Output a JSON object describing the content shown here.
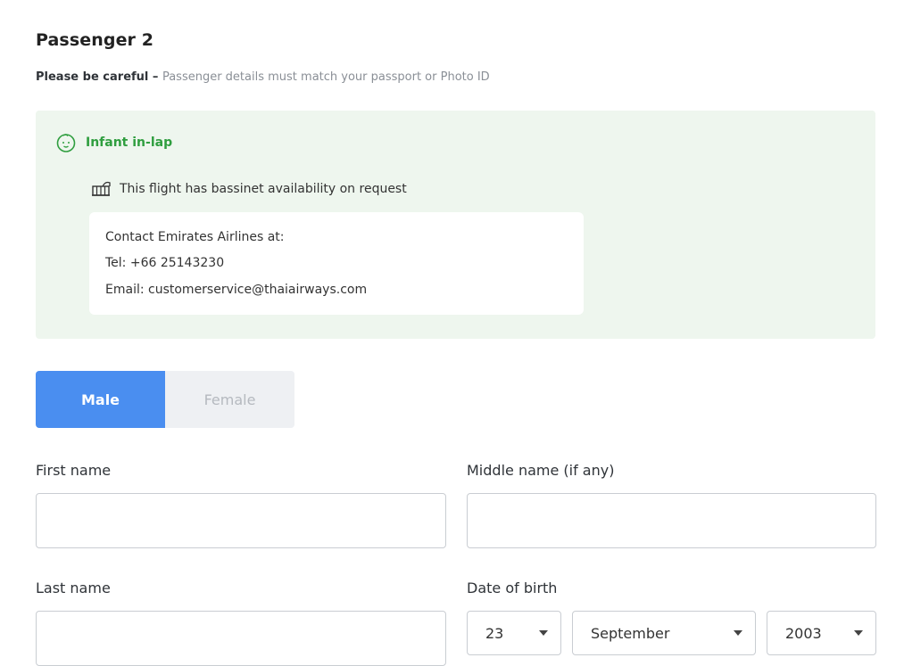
{
  "header": {
    "title": "Passenger 2",
    "warning_strong": "Please be careful",
    "warning_sep": " – ",
    "warning_text": "Passenger details must match your passport or Photo ID"
  },
  "infant": {
    "icon": "baby-face-icon",
    "label": "Infant in-lap",
    "bassinet_icon": "bassinet-icon",
    "bassinet_text": "This flight has bassinet availability on request",
    "contact": {
      "heading": "Contact Emirates Airlines at:",
      "tel": "Tel: +66 25143230",
      "email": "Email: customerservice@thaiairways.com"
    }
  },
  "gender": {
    "male": "Male",
    "female": "Female",
    "selected": "Male"
  },
  "form": {
    "first_name_label": "First name",
    "first_name_value": "",
    "middle_name_label": "Middle name (if any)",
    "middle_name_value": "",
    "last_name_label": "Last name",
    "last_name_value": "",
    "dob_label": "Date of birth",
    "dob_day": "23",
    "dob_month": "September",
    "dob_year": "2003"
  },
  "colors": {
    "accent": "#4a8ef0",
    "infant_green": "#2f9e3f",
    "infant_bg": "#eef6ee"
  }
}
